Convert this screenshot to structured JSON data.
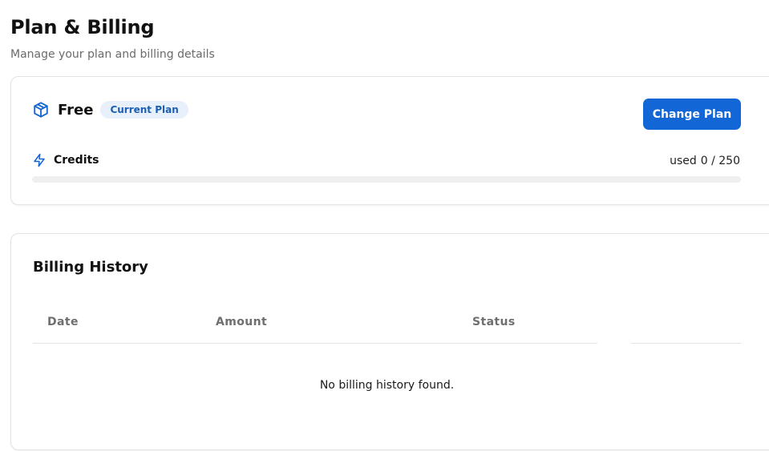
{
  "header": {
    "title": "Plan & Billing",
    "subtitle": "Manage your plan and billing details"
  },
  "plan": {
    "name": "Free",
    "badge": "Current Plan",
    "change_button_label": "Change Plan",
    "icon": "package-icon",
    "accent_color": "#1366d6"
  },
  "credits": {
    "label": "Credits",
    "icon": "lightning-icon",
    "used_word": "used",
    "used": 0,
    "total": 250,
    "usage_text": "0 / 250",
    "progress_fraction": 0
  },
  "billing_history": {
    "title": "Billing History",
    "columns": [
      "Date",
      "Amount",
      "Status"
    ],
    "rows": [],
    "empty_message": "No billing history found."
  }
}
